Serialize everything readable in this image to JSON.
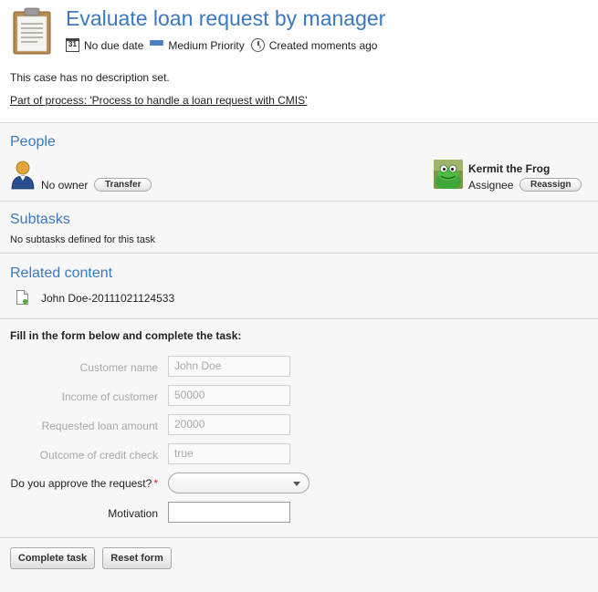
{
  "task": {
    "title": "Evaluate loan request by manager",
    "due": "No due date",
    "priority": "Medium Priority",
    "created": "Created moments ago",
    "calendar_day": "31",
    "description": "This case has no description set.",
    "process_link": "Part of process: 'Process to handle a loan request with CMIS'"
  },
  "people": {
    "heading": "People",
    "owner_text": "No owner",
    "transfer_label": "Transfer",
    "assignee_name": "Kermit the Frog",
    "assignee_role": "Assignee",
    "reassign_label": "Reassign"
  },
  "subtasks": {
    "heading": "Subtasks",
    "empty_text": "No subtasks defined for this task"
  },
  "related": {
    "heading": "Related content",
    "items": [
      "John Doe-20111021124533"
    ]
  },
  "form": {
    "intro": "Fill in the form below and complete the task:",
    "fields": [
      {
        "label": "Customer name",
        "value": "John Doe"
      },
      {
        "label": "Income of customer",
        "value": "50000"
      },
      {
        "label": "Requested loan amount",
        "value": "20000"
      },
      {
        "label": "Outcome of credit check",
        "value": "true"
      }
    ],
    "approve_label": "Do you approve the request?",
    "required_mark": "*",
    "approve_value": "",
    "motivation_label": "Motivation",
    "motivation_value": "",
    "complete_label": "Complete task",
    "reset_label": "Reset form"
  },
  "icons": {
    "header": "clipboard-icon",
    "due": "calendar-icon",
    "priority": "priority-icon",
    "created": "clock-icon",
    "owner": "user-icon",
    "assignee": "avatar",
    "related": "document-icon"
  },
  "colors": {
    "accent": "#3a78bf",
    "required": "#cc2222"
  }
}
